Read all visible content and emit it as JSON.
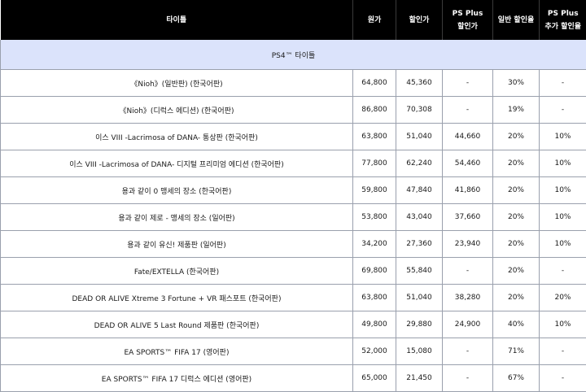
{
  "header": {
    "title": "타이틀",
    "original_price": "원가",
    "sale_price": "할인가",
    "ps_plus_price_line1": "PS Plus",
    "ps_plus_price_line2": "할인가",
    "normal_rate": "일반 할인율",
    "extra_rate_line1": "PS Plus",
    "extra_rate_line2": "추가 할인율"
  },
  "section_label": "PS4™ 타이틀",
  "rows": [
    {
      "title": "《Nioh》(일반판) (한국어판)",
      "original": "64,800",
      "sale": "45,360",
      "plus": "-",
      "rate": "30%",
      "extra": "-"
    },
    {
      "title": "《Nioh》(디럭스 에디션) (한국어판)",
      "original": "86,800",
      "sale": "70,308",
      "plus": "-",
      "rate": "19%",
      "extra": "-"
    },
    {
      "title": "이스 VIII -Lacrimosa of DANA- 통상판 (한국어판)",
      "original": "63,800",
      "sale": "51,040",
      "plus": "44,660",
      "rate": "20%",
      "extra": "10%"
    },
    {
      "title": "이스 VIII -Lacrimosa of DANA- 디지털 프리미엄 에디션 (한국어판)",
      "original": "77,800",
      "sale": "62,240",
      "plus": "54,460",
      "rate": "20%",
      "extra": "10%"
    },
    {
      "title": "용과 같이 0 맹세의 장소 (한국어판)",
      "original": "59,800",
      "sale": "47,840",
      "plus": "41,860",
      "rate": "20%",
      "extra": "10%"
    },
    {
      "title": "용과 같이 제로 - 맹세의 장소 (일어판)",
      "original": "53,800",
      "sale": "43,040",
      "plus": "37,660",
      "rate": "20%",
      "extra": "10%"
    },
    {
      "title": "용과 같이 유신! 제품판 (일어판)",
      "original": "34,200",
      "sale": "27,360",
      "plus": "23,940",
      "rate": "20%",
      "extra": "10%"
    },
    {
      "title": "Fate/EXTELLA (한국어판)",
      "original": "69,800",
      "sale": "55,840",
      "plus": "-",
      "rate": "20%",
      "extra": "-"
    },
    {
      "title": "DEAD OR ALIVE Xtreme 3 Fortune + VR 패스포트 (한국어판)",
      "original": "63,800",
      "sale": "51,040",
      "plus": "38,280",
      "rate": "20%",
      "extra": "20%"
    },
    {
      "title": "DEAD OR ALIVE 5 Last Round 제품판 (한국어판)",
      "original": "49,800",
      "sale": "29,880",
      "plus": "24,900",
      "rate": "40%",
      "extra": "10%"
    },
    {
      "title": "EA SPORTS™ FIFA 17 (영어판)",
      "original": "52,000",
      "sale": "15,080",
      "plus": "-",
      "rate": "71%",
      "extra": "-"
    },
    {
      "title": "EA SPORTS™ FIFA 17 디럭스 에디션 (영어판)",
      "original": "65,000",
      "sale": "21,450",
      "plus": "-",
      "rate": "67%",
      "extra": "-"
    }
  ]
}
